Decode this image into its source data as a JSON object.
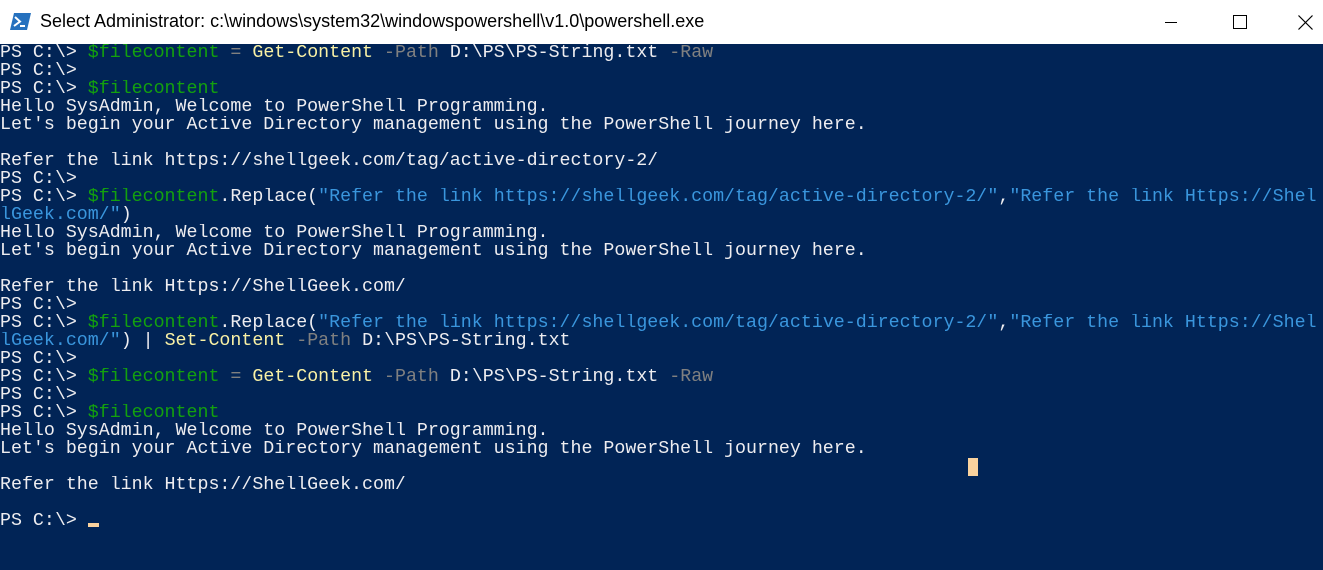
{
  "window": {
    "title": "Select Administrator: c:\\windows\\system32\\windowspowershell\\v1.0\\powershell.exe",
    "icon": "powershell-icon",
    "controls": {
      "minimize_icon": "minimize-icon",
      "maximize_icon": "maximize-icon",
      "close_icon": "close-icon"
    }
  },
  "colors": {
    "console_background": "#012456",
    "default_text": "#eeedf0",
    "variable": "#13a10e",
    "command": "#f9f1a5",
    "parameter": "#808080",
    "string": "#3a96dd",
    "cursor": "#f9d29e"
  },
  "terminal": {
    "lines": [
      [
        {
          "t": "PS C:\\> ",
          "c": "default"
        },
        {
          "t": "$filecontent",
          "c": "var"
        },
        {
          "t": " = ",
          "c": "param"
        },
        {
          "t": "Get-Content",
          "c": "cmd"
        },
        {
          "t": " -Path",
          "c": "param"
        },
        {
          "t": " D:\\PS\\PS-String.txt",
          "c": "default"
        },
        {
          "t": " -Raw",
          "c": "param"
        }
      ],
      [
        {
          "t": "PS C:\\>",
          "c": "default"
        }
      ],
      [
        {
          "t": "PS C:\\> ",
          "c": "default"
        },
        {
          "t": "$filecontent",
          "c": "var"
        }
      ],
      [
        {
          "t": "Hello SysAdmin, Welcome to PowerShell Programming.",
          "c": "default"
        }
      ],
      [
        {
          "t": "Let's begin your Active Directory management using the PowerShell journey here.",
          "c": "default"
        }
      ],
      [],
      [
        {
          "t": "Refer the link https://shellgeek.com/tag/active-directory-2/",
          "c": "default"
        }
      ],
      [
        {
          "t": "PS C:\\>",
          "c": "default"
        }
      ],
      [
        {
          "t": "PS C:\\> ",
          "c": "default"
        },
        {
          "t": "$filecontent",
          "c": "var"
        },
        {
          "t": ".Replace(",
          "c": "default"
        },
        {
          "t": "\"Refer the link https://shellgeek.com/tag/active-directory-2/\"",
          "c": "str"
        },
        {
          "t": ",",
          "c": "default"
        },
        {
          "t": "\"Refer the link Https://Shel",
          "c": "str"
        }
      ],
      [
        {
          "t": "lGeek.com/\"",
          "c": "str"
        },
        {
          "t": ")",
          "c": "default"
        }
      ],
      [
        {
          "t": "Hello SysAdmin, Welcome to PowerShell Programming.",
          "c": "default"
        }
      ],
      [
        {
          "t": "Let's begin your Active Directory management using the PowerShell journey here.",
          "c": "default"
        }
      ],
      [],
      [
        {
          "t": "Refer the link Https://ShellGeek.com/",
          "c": "default"
        }
      ],
      [
        {
          "t": "PS C:\\>",
          "c": "default"
        }
      ],
      [
        {
          "t": "PS C:\\> ",
          "c": "default"
        },
        {
          "t": "$filecontent",
          "c": "var"
        },
        {
          "t": ".Replace(",
          "c": "default"
        },
        {
          "t": "\"Refer the link https://shellgeek.com/tag/active-directory-2/\"",
          "c": "str"
        },
        {
          "t": ",",
          "c": "default"
        },
        {
          "t": "\"Refer the link Https://Shel",
          "c": "str"
        }
      ],
      [
        {
          "t": "lGeek.com/\"",
          "c": "str"
        },
        {
          "t": ") | ",
          "c": "default"
        },
        {
          "t": "Set-Content",
          "c": "cmd"
        },
        {
          "t": " -Path",
          "c": "param"
        },
        {
          "t": " D:\\PS\\PS-String.txt",
          "c": "default"
        }
      ],
      [
        {
          "t": "PS C:\\>",
          "c": "default"
        }
      ],
      [
        {
          "t": "PS C:\\> ",
          "c": "default"
        },
        {
          "t": "$filecontent",
          "c": "var"
        },
        {
          "t": " = ",
          "c": "param"
        },
        {
          "t": "Get-Content",
          "c": "cmd"
        },
        {
          "t": " -Path",
          "c": "param"
        },
        {
          "t": " D:\\PS\\PS-String.txt",
          "c": "default"
        },
        {
          "t": " -Raw",
          "c": "param"
        }
      ],
      [
        {
          "t": "PS C:\\>",
          "c": "default"
        }
      ],
      [
        {
          "t": "PS C:\\> ",
          "c": "default"
        },
        {
          "t": "$filecontent",
          "c": "var"
        }
      ],
      [
        {
          "t": "Hello SysAdmin, Welcome to PowerShell Programming.",
          "c": "default"
        }
      ],
      [
        {
          "t": "Let's begin your Active Directory management using the PowerShell journey here.",
          "c": "default"
        }
      ],
      [],
      [
        {
          "t": "Refer the link Https://ShellGeek.com/",
          "c": "default"
        }
      ],
      [],
      [
        {
          "t": "PS C:\\> ",
          "c": "default"
        }
      ]
    ]
  }
}
